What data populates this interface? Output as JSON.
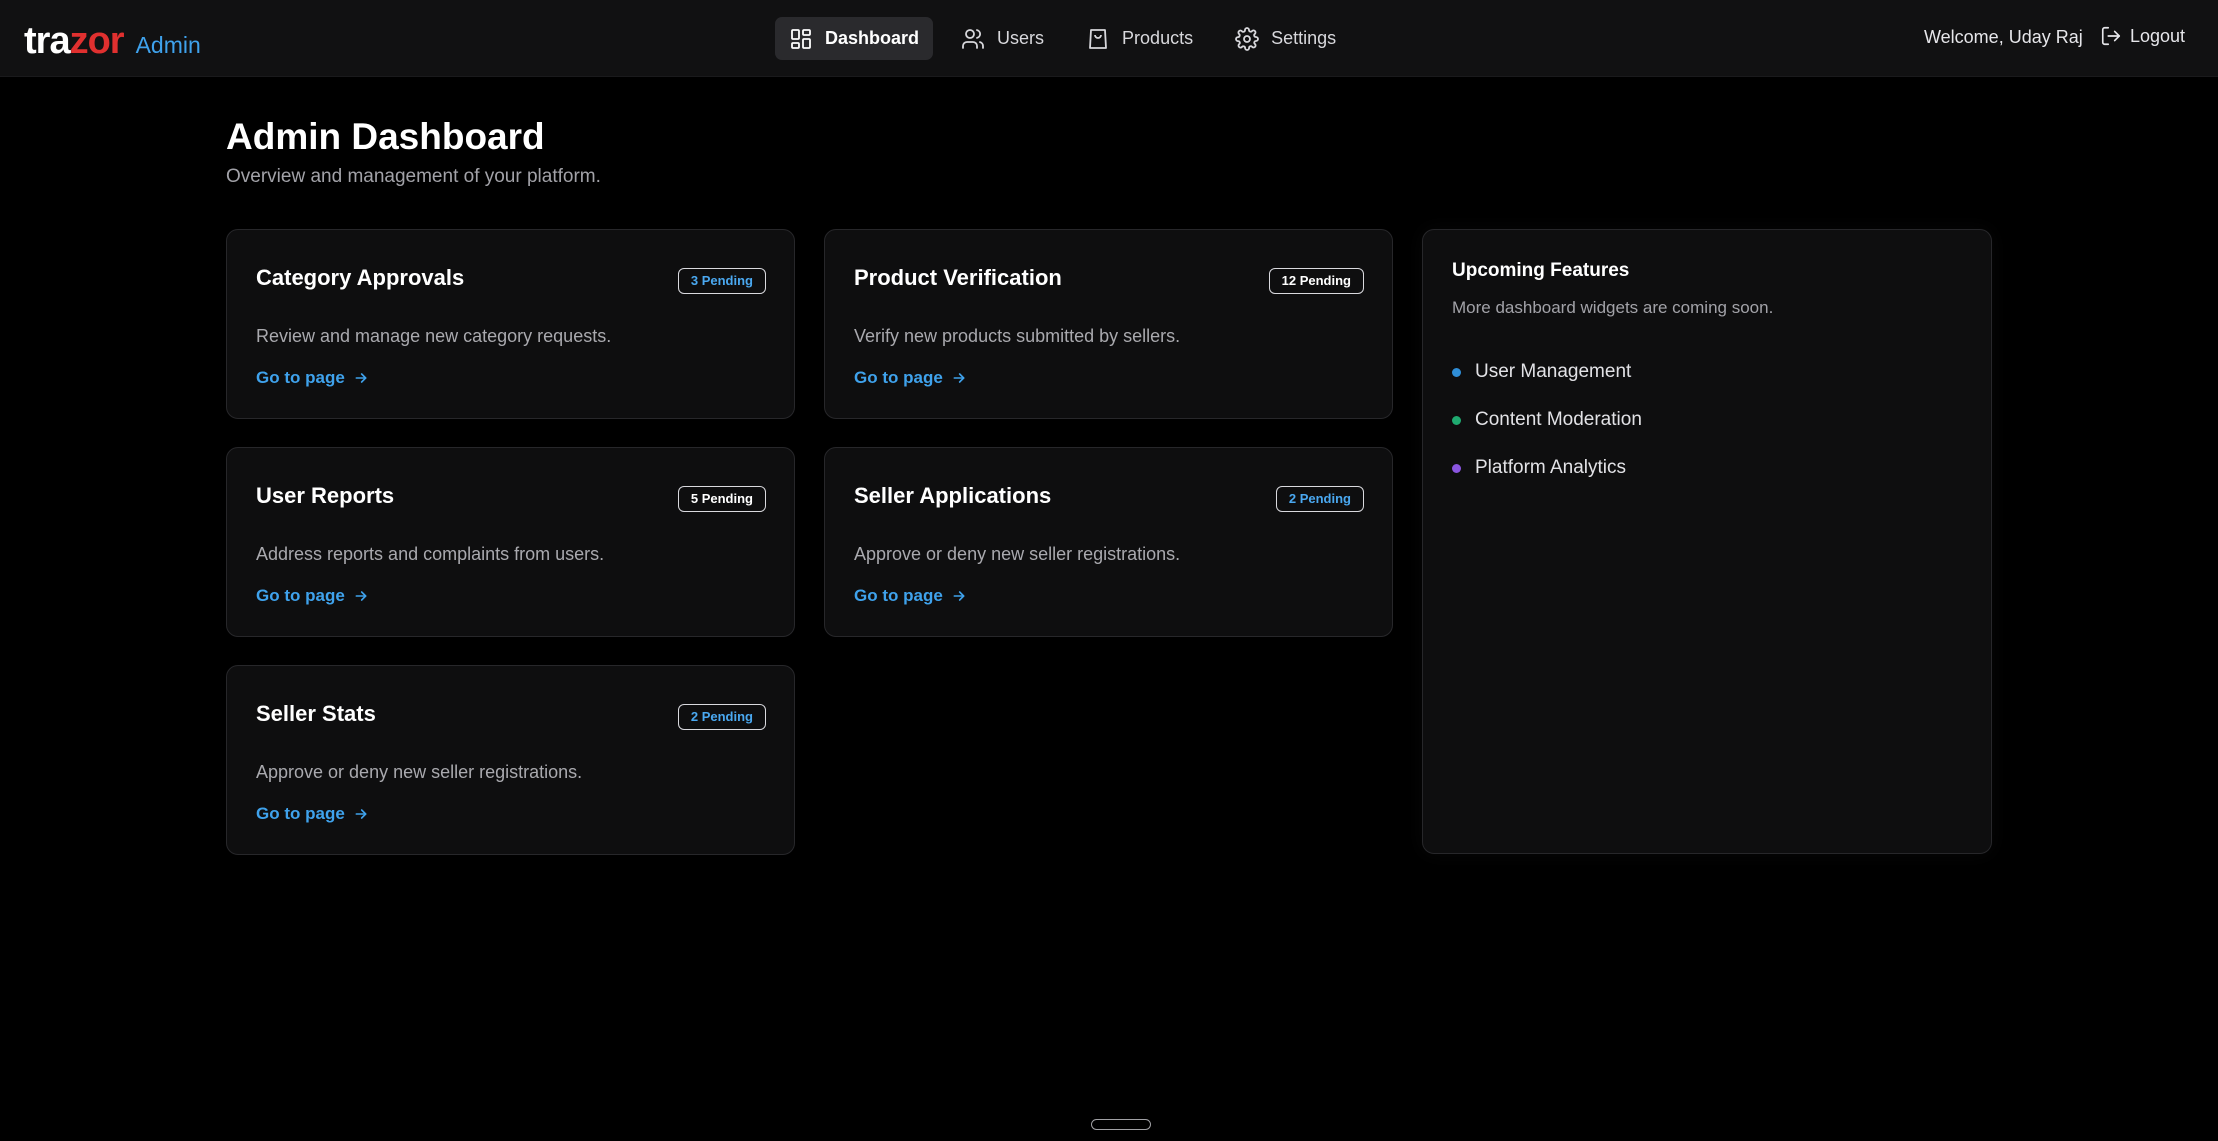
{
  "header": {
    "logo_part1": "tra",
    "logo_part2": "zor",
    "logo_suffix": "Admin",
    "nav": [
      {
        "label": "Dashboard",
        "icon": "dashboard-grid-icon"
      },
      {
        "label": "Users",
        "icon": "users-icon"
      },
      {
        "label": "Products",
        "icon": "shopping-bag-icon"
      },
      {
        "label": "Settings",
        "icon": "gear-icon"
      }
    ],
    "welcome": "Welcome, Uday Raj",
    "logout_label": "Logout"
  },
  "main": {
    "title": "Admin Dashboard",
    "subtitle": "Overview and management of your platform.",
    "cards": [
      {
        "title": "Category Approvals",
        "badge": "3 Pending",
        "badge_color": "#4aa8f0",
        "description": "Review and manage new category requests.",
        "link": "Go to page"
      },
      {
        "title": "Product Verification",
        "badge": "12 Pending",
        "badge_color": "#ffffff",
        "description": "Verify new products submitted by sellers.",
        "link": "Go to page"
      },
      {
        "title": "User Reports",
        "badge": "5 Pending",
        "badge_color": "#ffffff",
        "description": "Address reports and complaints from users.",
        "link": "Go to page"
      },
      {
        "title": "Seller Applications",
        "badge": "2 Pending",
        "badge_color": "#4aa8f0",
        "description": "Approve or deny new seller registrations.",
        "link": "Go to page"
      },
      {
        "title": "Seller Stats",
        "badge": "2 Pending",
        "badge_color": "#4aa8f0",
        "description": "Approve or deny new seller registrations.",
        "link": "Go to page"
      }
    ],
    "upcoming": {
      "title": "Upcoming Features",
      "subtitle": "More dashboard widgets are coming soon.",
      "items": [
        {
          "label": "User Management",
          "color": "#2f8ed8"
        },
        {
          "label": "Content Moderation",
          "color": "#1faa70"
        },
        {
          "label": "Platform Analytics",
          "color": "#8a55e0"
        }
      ]
    }
  },
  "colors": {
    "accent": "#3fa2ec",
    "brand_red": "#e0302f",
    "background": "#000000",
    "card": "#0e0e0f"
  }
}
